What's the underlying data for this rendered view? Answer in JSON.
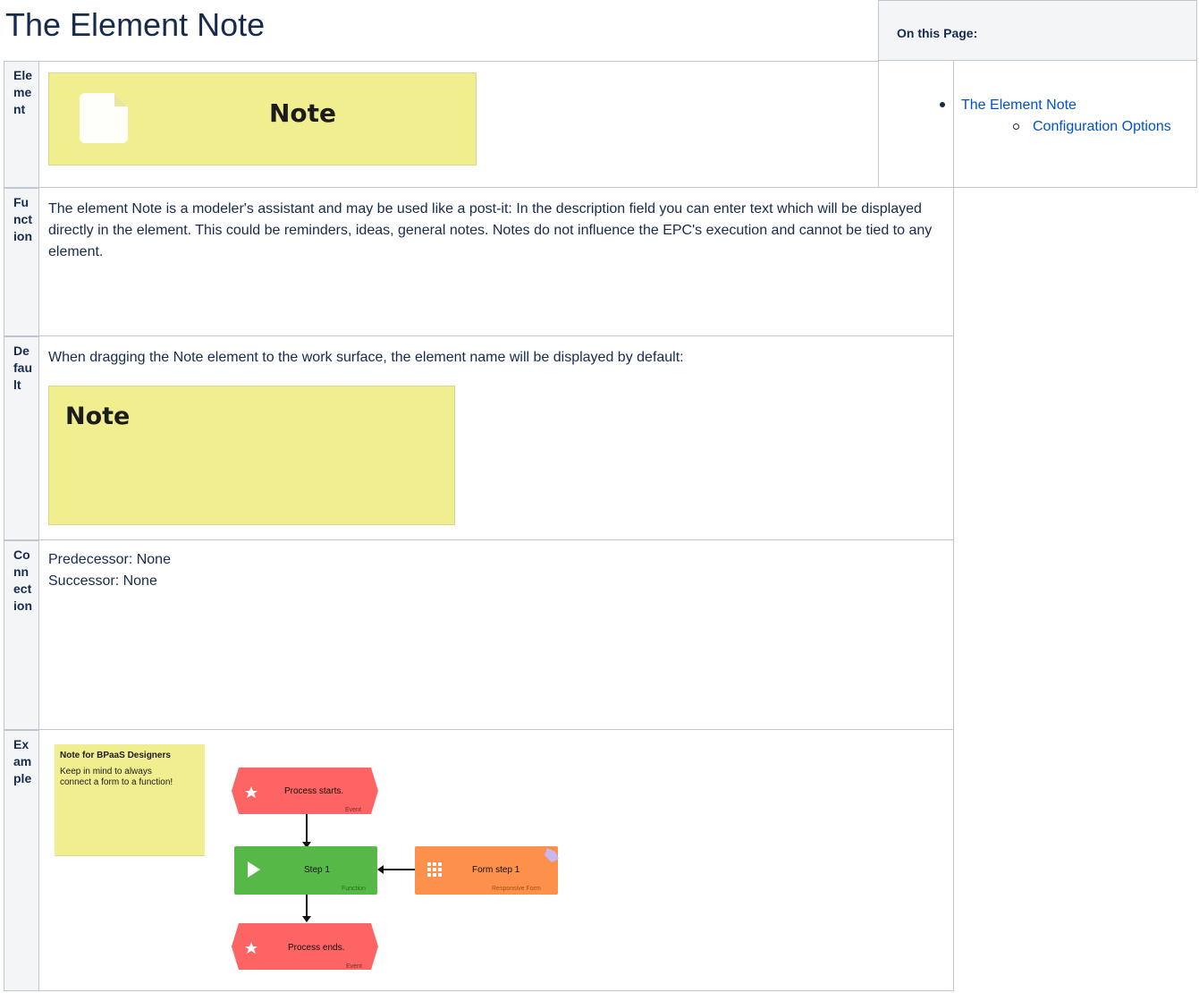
{
  "page": {
    "title": "The Element Note"
  },
  "toc": {
    "heading": "On this Page:",
    "items": [
      {
        "label": "The Element Note",
        "level": 1
      },
      {
        "label": "Configuration Options",
        "level": 2
      }
    ]
  },
  "rows": {
    "element": {
      "label": "Element",
      "image_text": "Note"
    },
    "function": {
      "label": "Function",
      "text": "The element Note is a modeler's assistant and may be used like a post-it: In the description field you can enter text which will be displayed directly in the element. This could be reminders, ideas, general notes. Notes do not influence the EPC's execution and cannot be tied to any element."
    },
    "default": {
      "label": "Default",
      "text": "When dragging the Note element to the work surface, the element name will be displayed by default:",
      "image_text": "Note"
    },
    "connection": {
      "label": "Connection",
      "predecessor": "Predecessor: None",
      "successor": "Successor: None"
    },
    "example": {
      "label": "Example",
      "note_title": "Note for BPaaS Designers",
      "note_body": "Keep in mind to always connect a form to a function!",
      "process_starts": "Process starts.",
      "process_starts_type": "Event",
      "step1": "Step 1",
      "step1_type": "Function",
      "form_step": "Form step 1",
      "form_step_type": "Responsive Form",
      "process_ends": "Process ends.",
      "process_ends_type": "Event"
    }
  },
  "colors": {
    "note_yellow": "#f0ee8f",
    "event_red": "#fd6464",
    "function_green": "#56b947",
    "form_orange": "#fd914c",
    "link_blue": "#0052cc"
  }
}
